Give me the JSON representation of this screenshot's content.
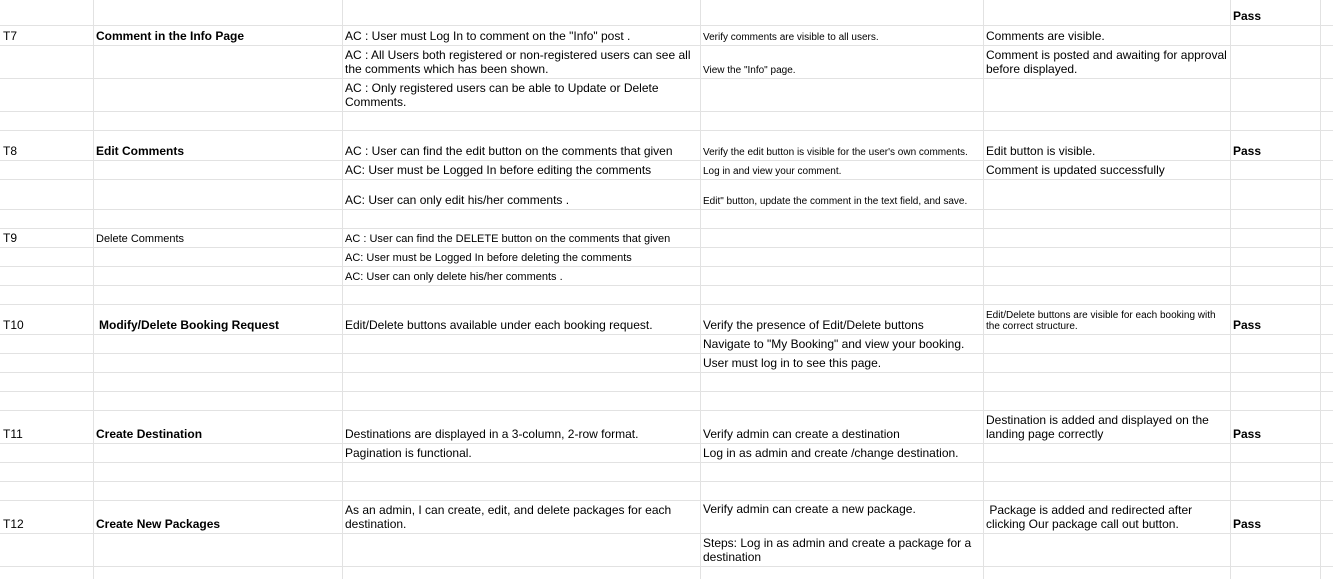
{
  "t7": {
    "id": "T7",
    "name": "Comment in the Info Page",
    "criteria": [
      "AC : User must Log In to comment on the \"Info\" post .",
      "AC : All Users both registered or non-registered users can see all the comments which has been shown.",
      "AC : Only registered users can be able to Update or Delete Comments."
    ],
    "steps": [
      "Verify comments are visible to all users.",
      "View the \"Info\" page."
    ],
    "expected": [
      "Comments are visible.",
      "Comment is posted and awaiting for approval before displayed."
    ],
    "status": "Pass"
  },
  "t8": {
    "id": "T8",
    "name": "Edit Comments",
    "criteria": [
      "AC : User can find the edit button on the comments that given",
      "AC: User must be Logged In before editing the comments",
      "AC: User can only edit his/her comments ."
    ],
    "steps": [
      "Verify the edit button is visible for the user's own comments.",
      "Log in and view your comment.",
      "Edit\" button, update the comment in the text field, and save."
    ],
    "expected": [
      "Edit button is visible.",
      "Comment is updated successfully"
    ],
    "status": "Pass"
  },
  "t9": {
    "id": "T9",
    "name": "Delete Comments",
    "criteria": [
      "AC : User can find the DELETE button on the comments that given",
      "AC: User must be Logged In before deleting the comments",
      "AC: User can only delete his/her comments ."
    ]
  },
  "t10": {
    "id": "T10",
    "name": "Modify/Delete Booking Request",
    "criteria": [
      "Edit/Delete buttons available under each booking request."
    ],
    "steps": [
      "Verify the presence of Edit/Delete buttons",
      "Navigate to \"My Booking\" and view your booking.",
      "User must log in to see this page."
    ],
    "expected": [
      "Edit/Delete buttons are visible for each booking with the correct structure."
    ],
    "status": "Pass"
  },
  "t11": {
    "id": "T11",
    "name": "Create Destination",
    "criteria": [
      "Destinations are displayed in a 3-column, 2-row format.",
      "Pagination is functional."
    ],
    "steps": [
      "Verify admin can create a destination",
      "Log in as admin and create /change destination."
    ],
    "expected": [
      "Destination is added and displayed on the landing page correctly"
    ],
    "status": "Pass"
  },
  "t12": {
    "id": "T12",
    "name": "Create New Packages",
    "criteria": [
      "As an admin, I can create, edit, and delete packages for each destination."
    ],
    "steps": [
      "Verify admin can create a new package.",
      "Steps: Log in as admin and create a package for a destination"
    ],
    "expected": [
      " Package is added and redirected after clicking Our package call out button."
    ],
    "status": "Pass"
  }
}
